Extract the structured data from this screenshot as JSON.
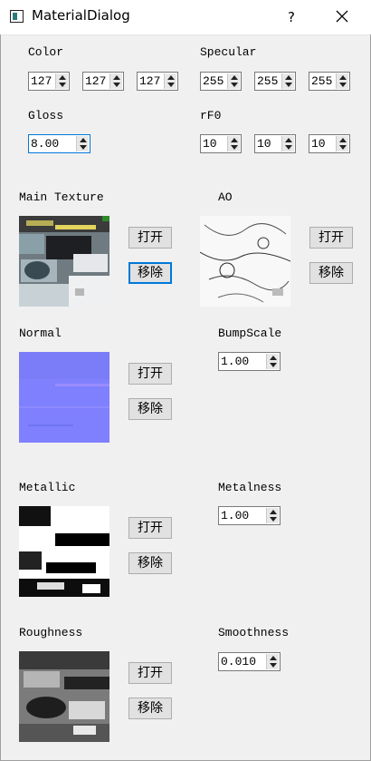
{
  "window": {
    "title": "MaterialDialog",
    "help_glyph": "?"
  },
  "color": {
    "label": "Color",
    "values": [
      "127",
      "127",
      "127"
    ]
  },
  "specular": {
    "label": "Specular",
    "values": [
      "255",
      "255",
      "255"
    ]
  },
  "gloss": {
    "label": "Gloss",
    "value": "8.00"
  },
  "rf0": {
    "label": "rF0",
    "values": [
      "10",
      "10",
      "10"
    ]
  },
  "main_texture": {
    "label": "Main Texture",
    "open_label": "打开",
    "remove_label": "移除"
  },
  "ao": {
    "label": "AO",
    "open_label": "打开",
    "remove_label": "移除"
  },
  "normal": {
    "label": "Normal",
    "open_label": "打开",
    "remove_label": "移除"
  },
  "bump_scale": {
    "label": "BumpScale",
    "value": "1.00"
  },
  "metallic": {
    "label": "Metallic",
    "open_label": "打开",
    "remove_label": "移除"
  },
  "metalness": {
    "label": "Metalness",
    "value": "1.00"
  },
  "roughness": {
    "label": "Roughness",
    "open_label": "打开",
    "remove_label": "移除"
  },
  "smoothness": {
    "label": "Smoothness",
    "value": "0.010"
  },
  "colors": {
    "focus": "#0078d7",
    "normal_map": "#7f80fd",
    "button": "#e1e1e1"
  }
}
